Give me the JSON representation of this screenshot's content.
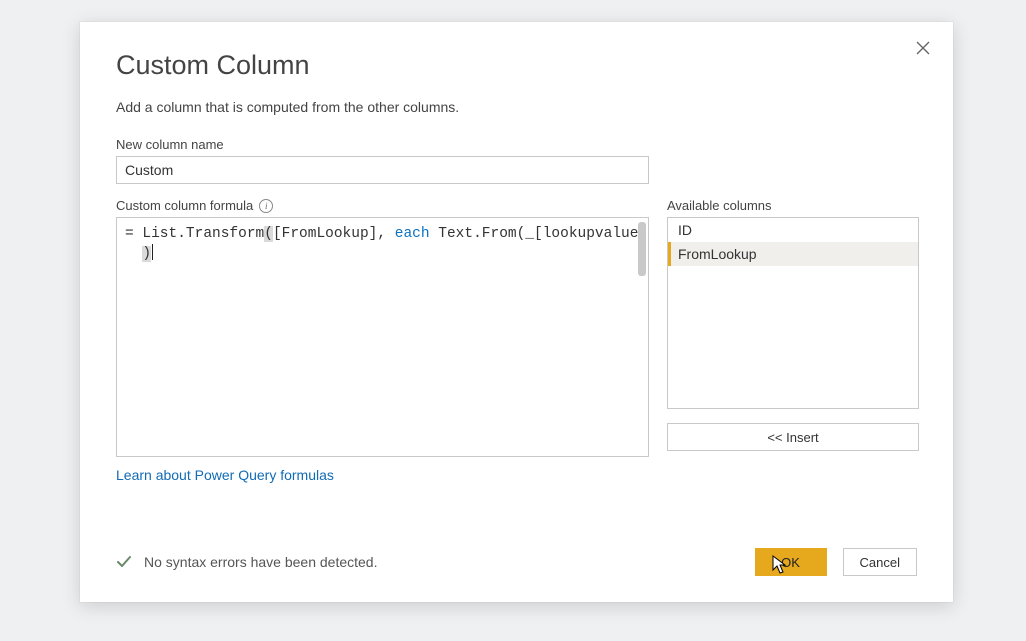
{
  "dialog": {
    "title": "Custom Column",
    "subtitle": "Add a column that is computed from the other columns.",
    "name_label": "New column name",
    "name_value": "Custom",
    "formula_label": "Custom column formula",
    "formula_line1_prefix": "= ",
    "formula_line1_fn1": "List.Transform",
    "formula_line1_open": "(",
    "formula_line1_arg1": "[FromLookup], ",
    "formula_line1_kw": "each",
    "formula_line1_mid": " ",
    "formula_line1_fn2": "Text.From",
    "formula_line1_arg2": "(_[lookupvalue]) ",
    "formula_line2_close": ")",
    "available_label": "Available columns",
    "available_columns": [
      "ID",
      "FromLookup"
    ],
    "selected_index": 1,
    "insert_label": "<< Insert",
    "learn_link": "Learn about Power Query formulas",
    "status_text": "No syntax errors have been detected.",
    "ok_label": "OK",
    "cancel_label": "Cancel"
  }
}
